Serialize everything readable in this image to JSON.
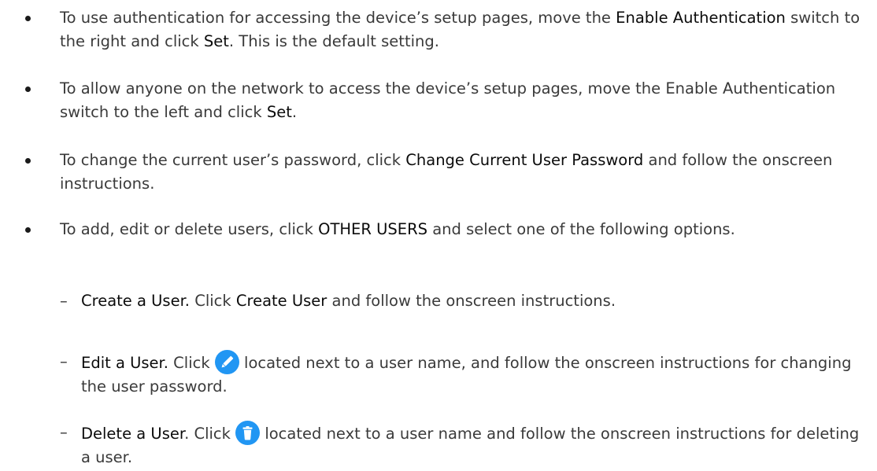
{
  "bullets": [
    {
      "parts": [
        "To use authentication for accessing the device’s setup pages, move the ",
        "Enable Authentication",
        " switch to the right and click ",
        "Set",
        ". This is the default setting."
      ]
    },
    {
      "parts": [
        "To allow anyone on the network to access the device’s setup pages, move the Enable Authentication switch to the left and click ",
        "Set",
        "."
      ]
    },
    {
      "parts": [
        "To change the current user’s password, click ",
        "Change Current User Password",
        " and follow the onscreen instructions."
      ]
    },
    {
      "parts": [
        "To add, edit or delete users, click ",
        "OTHER USERS",
        " and select one of the following options."
      ]
    }
  ],
  "sub_items": [
    {
      "dash": "–",
      "title": "Create a User.",
      "text_a": " Click ",
      "action": "Create User",
      "text_b": " and follow the onscreen instructions."
    },
    {
      "dash": "–",
      "title": "Edit a User.",
      "text_a": " Click ",
      "icon": "pencil-icon",
      "text_b": " located next to a user name, and follow the onscreen instructions for changing the user password."
    },
    {
      "dash": "–",
      "title": "Delete a User",
      "text_a": ". Click ",
      "icon": "trash-icon",
      "text_b": " located next to a user name and follow the onscreen instructions for deleting a user."
    }
  ],
  "colors": {
    "icon_blue": "#2196f3",
    "text": "#3a3a3a",
    "bold_text": "#0b0b0b"
  }
}
